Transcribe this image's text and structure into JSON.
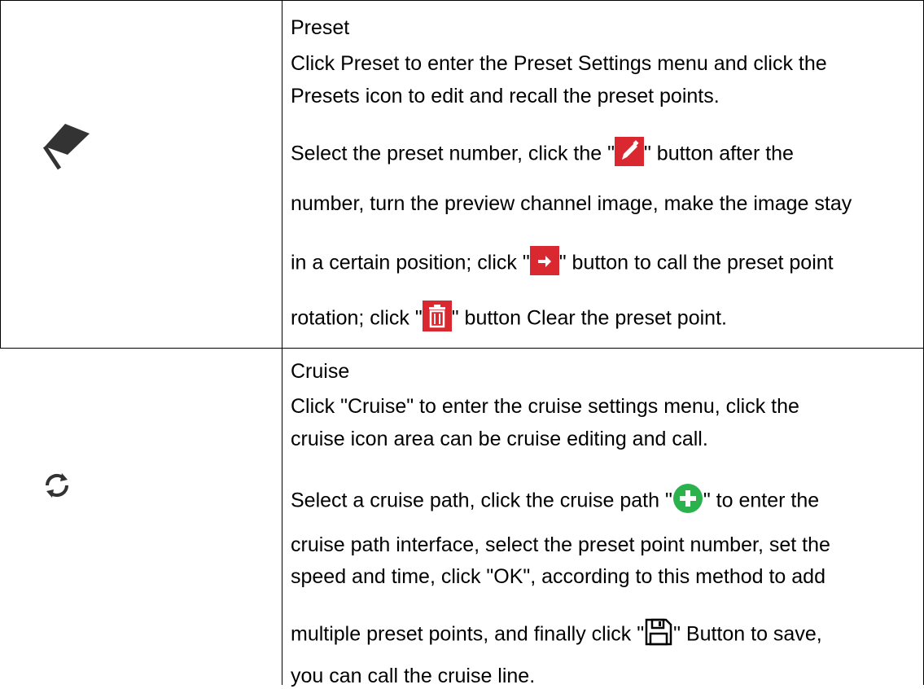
{
  "rows": [
    {
      "icon": "flag-icon",
      "title": "Preset",
      "lines": [
        "Click Preset to enter the Preset Settings menu and click the",
        "Presets icon to edit and recall the preset points.",
        "Select the preset number, click the \"",
        "\" button after the",
        "number, turn the preview channel image, make the image stay",
        "in a certain position; click \"",
        "\" button to call the preset point",
        "rotation; click \"",
        "\" button Clear the preset point."
      ],
      "inline_icons": [
        "pencil-icon",
        "arrow-right-icon",
        "trash-icon"
      ],
      "colors": {
        "icon_red": "#d9282f"
      }
    },
    {
      "icon": "refresh-icon",
      "title": "Cruise",
      "lines": [
        "Click \"Cruise\" to enter the cruise settings menu, click the",
        "cruise icon area can be cruise editing and call.",
        "Select a cruise path, click the cruise path \"",
        "\" to enter the",
        "cruise path interface, select the preset point number, set the",
        "speed and time, click \"OK\", according to this method to add",
        "multiple preset points, and finally click \"",
        "\" Button to save,",
        "you can call the cruise line."
      ],
      "inline_icons": [
        "plus-circle-icon",
        "save-icon"
      ],
      "colors": {
        "plus_green": "#2bb24c"
      }
    }
  ]
}
